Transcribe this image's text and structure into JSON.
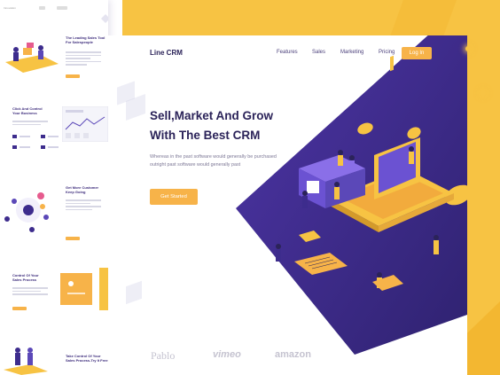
{
  "left_panel": {
    "header_logo": "Innovation",
    "sections": [
      {
        "title": "The Leading Sales Tool\nFor Salespeople"
      },
      {
        "title": "Click And Control\nYour Business"
      },
      {
        "title": "Get More Customer\nKeep Going"
      },
      {
        "title": "Control Of Your\nSales Process"
      },
      {
        "title": "Take Control Of Your\nSales Process-Try It Free"
      }
    ]
  },
  "nav": {
    "logo": "Line CRM",
    "links": [
      "Features",
      "Sales",
      "Marketing",
      "Pricing"
    ],
    "login": "Log In"
  },
  "hero": {
    "title": "Sell,Market And Grow With The Best CRM",
    "description": "Whereas in the past software would generally be purchased outright  past software would generally past",
    "cta": "Get Started"
  },
  "partners": [
    "Pablo",
    "vimeo",
    "amazon"
  ],
  "colors": {
    "purple": "#3d2c8d",
    "yellow": "#f7c343",
    "orange": "#f7b349",
    "navy_text": "#2b2359"
  }
}
